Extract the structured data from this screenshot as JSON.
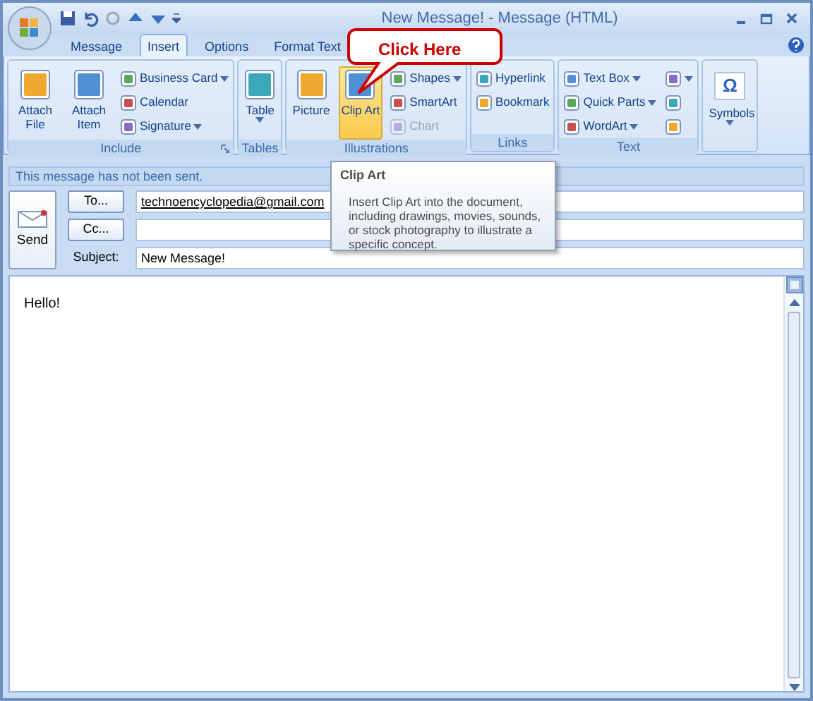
{
  "window": {
    "title": "New Message! - Message (HTML)"
  },
  "tabs": [
    {
      "label": "Message",
      "selected": false
    },
    {
      "label": "Insert",
      "selected": true
    },
    {
      "label": "Options",
      "selected": false
    },
    {
      "label": "Format Text",
      "selected": false
    }
  ],
  "ribbon": [
    {
      "label": "Include",
      "launcher": true,
      "items": [
        {
          "kind": "large",
          "label": "Attach File"
        },
        {
          "kind": "large",
          "label": "Attach Item"
        },
        {
          "kind": "column",
          "items": [
            {
              "label": "Business Card",
              "dropdown": true
            },
            {
              "label": "Calendar",
              "dropdown": false
            },
            {
              "label": "Signature",
              "dropdown": true
            }
          ]
        }
      ]
    },
    {
      "label": "Tables",
      "launcher": false,
      "items": [
        {
          "kind": "large",
          "label": "Table",
          "dropdown": true
        }
      ]
    },
    {
      "label": "Illustrations",
      "launcher": false,
      "items": [
        {
          "kind": "large",
          "label": "Picture"
        },
        {
          "kind": "large",
          "label": "Clip Art",
          "highlighted": true
        },
        {
          "kind": "column",
          "items": [
            {
              "label": "Shapes",
              "dropdown": true
            },
            {
              "label": "SmartArt",
              "dropdown": false
            },
            {
              "label": "Chart",
              "dropdown": false,
              "disabled": true
            }
          ]
        }
      ]
    },
    {
      "label": "Links",
      "launcher": false,
      "items": [
        {
          "kind": "column",
          "items": [
            {
              "label": "Hyperlink",
              "dropdown": false
            },
            {
              "label": "Bookmark",
              "dropdown": false
            }
          ]
        }
      ]
    },
    {
      "label": "Text",
      "launcher": false,
      "items": [
        {
          "kind": "column",
          "items": [
            {
              "label": "Text Box",
              "dropdown": true
            },
            {
              "label": "Quick Parts",
              "dropdown": true
            },
            {
              "label": "WordArt",
              "dropdown": true
            }
          ]
        },
        {
          "kind": "column",
          "items": [
            {
              "dropdown": true
            },
            {
              "dropdown": false
            },
            {
              "dropdown": false
            }
          ]
        }
      ]
    },
    {
      "launcher": false,
      "items": [
        {
          "kind": "large",
          "label": "Symbols",
          "glyph": "Ω",
          "dropdown": true
        }
      ]
    }
  ],
  "callout": {
    "text": "Click Here"
  },
  "tooltip": {
    "title": "Clip Art",
    "body": "Insert Clip Art into the document, including drawings, movies, sounds, or stock photography to illustrate a specific concept."
  },
  "info_bar": "This message has not been sent.",
  "send": {
    "label": "Send"
  },
  "fields": [
    {
      "kind": "button",
      "label": "To...",
      "value": "technoencyclopedia@gmail.com"
    },
    {
      "kind": "button",
      "label": "Cc..."
    },
    {
      "kind": "label",
      "label": "Subject:",
      "value": "New Message!"
    }
  ],
  "body": "Hello!"
}
